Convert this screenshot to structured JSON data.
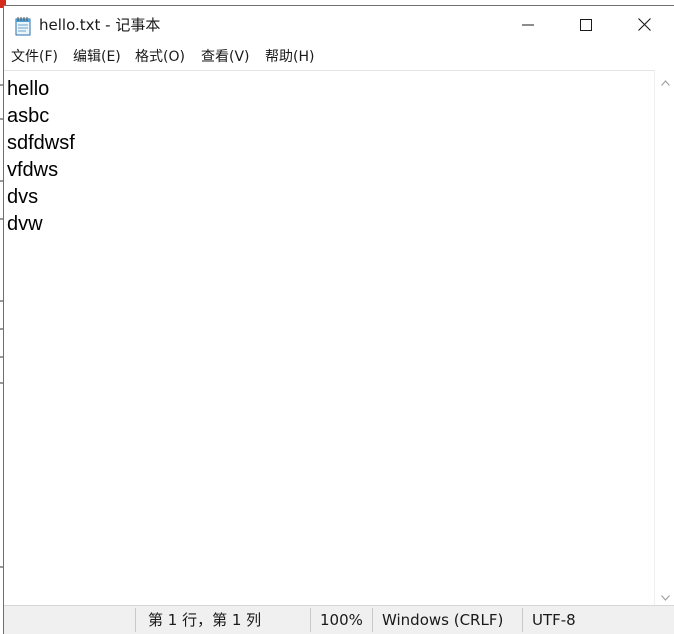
{
  "window": {
    "title": "hello.txt - 记事本"
  },
  "caption_buttons": {
    "minimize_icon": "minimize-icon",
    "maximize_icon": "maximize-icon",
    "close_icon": "close-icon"
  },
  "menu": {
    "items": [
      {
        "label": "文件(F)"
      },
      {
        "label": "编辑(E)"
      },
      {
        "label": "格式(O)"
      },
      {
        "label": "查看(V)"
      },
      {
        "label": "帮助(H)"
      }
    ]
  },
  "editor": {
    "lines": [
      "hello",
      "asbc",
      "sdfdwsf",
      "vfdws",
      "dvs",
      "dvw"
    ]
  },
  "status": {
    "position": "第 1 行，第 1 列",
    "zoom": "100%",
    "line_ending": "Windows (CRLF)",
    "encoding": "UTF-8"
  },
  "colors": {
    "titlebar_bg": "#ffffff",
    "statusbar_bg": "#f0f0f0",
    "text": "#000000"
  }
}
